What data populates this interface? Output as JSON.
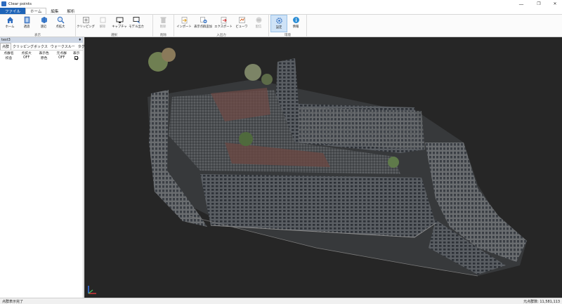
{
  "window": {
    "title": "Clear points",
    "minimize": "—",
    "maximize": "❐",
    "close": "✕"
  },
  "tabs": [
    "ファイル",
    "ホーム",
    "編集",
    "解析"
  ],
  "ribbon": {
    "groups": [
      {
        "label": "表示",
        "buttons": [
          {
            "label": "ホーム",
            "icon": "home-icon"
          },
          {
            "label": "透過",
            "icon": "transparency-icon"
          },
          {
            "label": "遠近",
            "icon": "perspective-icon"
          },
          {
            "label": "点拡大",
            "icon": "point-enlarge-icon"
          }
        ]
      },
      {
        "label": "選択",
        "buttons": [
          {
            "label": "クリッピング",
            "icon": "clipping-icon"
          },
          {
            "label": "解除",
            "icon": "release-icon"
          },
          {
            "label": "キャプチャ",
            "icon": "capture-icon"
          },
          {
            "label": "モデル出力",
            "icon": "model-output-icon"
          }
        ]
      },
      {
        "label": "削除",
        "buttons": [
          {
            "label": "削除",
            "icon": "delete-icon"
          }
        ]
      },
      {
        "label": "入出力",
        "buttons": [
          {
            "label": "インポート",
            "icon": "import-icon"
          },
          {
            "label": "表示点群追加",
            "icon": "add-points-icon"
          },
          {
            "label": "エクスポート",
            "icon": "export-icon"
          },
          {
            "label": "ビューワ",
            "icon": "viewer-icon"
          },
          {
            "label": "配信",
            "icon": "publish-icon"
          }
        ]
      },
      {
        "label": "環境",
        "buttons": [
          {
            "label": "設定",
            "icon": "settings-icon"
          },
          {
            "label": "情報",
            "icon": "info-icon"
          }
        ]
      }
    ]
  },
  "panel": {
    "title": "test3",
    "pin": "♦",
    "tabs": [
      "点群",
      "クリッピングボックス",
      "ウォークスルー",
      "タグ"
    ],
    "columns": [
      "点群名",
      "点拡大",
      "表示色",
      "元点群",
      "表示"
    ],
    "rows": [
      {
        "name": "校舎",
        "enlarge": "OFF",
        "color": "原色",
        "original": "OFF",
        "visible": "✓"
      }
    ]
  },
  "status": {
    "left": "点群表示完了",
    "right": "元点群数: 11,581,113"
  },
  "colors": {
    "accent": "#1e64b8",
    "viewport_bg": "#262626",
    "panel_header": "#cfd8e6"
  }
}
